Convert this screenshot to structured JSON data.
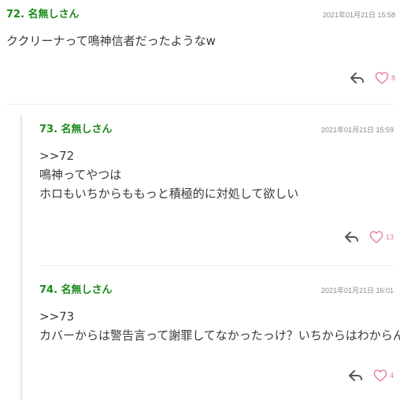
{
  "comments": [
    {
      "number_name": "72. 名無しさん",
      "date": "2021年01月21日 15:58",
      "lines": [
        "ククリーナって鳴神信者だったようなw"
      ],
      "likes": "8"
    },
    {
      "number_name": "73. 名無しさん",
      "date": "2021年01月21日 15:59",
      "lines": [
        ">>72",
        "鳴神ってやつは",
        "ホロもいちからももっと積極的に対処して欲しい"
      ],
      "likes": "13"
    },
    {
      "number_name": "74. 名無しさん",
      "date": "2021年01月21日 16:01",
      "lines": [
        ">>73",
        "カバーからは警告言って謝罪してなかったっけ？いちからはわからん"
      ],
      "likes": "4"
    }
  ],
  "icons": {
    "reply": "reply-arrow-icon",
    "like": "heart-outline-icon"
  },
  "colors": {
    "name": "#1a8a1a",
    "heart": "#e57c9c",
    "date": "#8a8a8a"
  }
}
